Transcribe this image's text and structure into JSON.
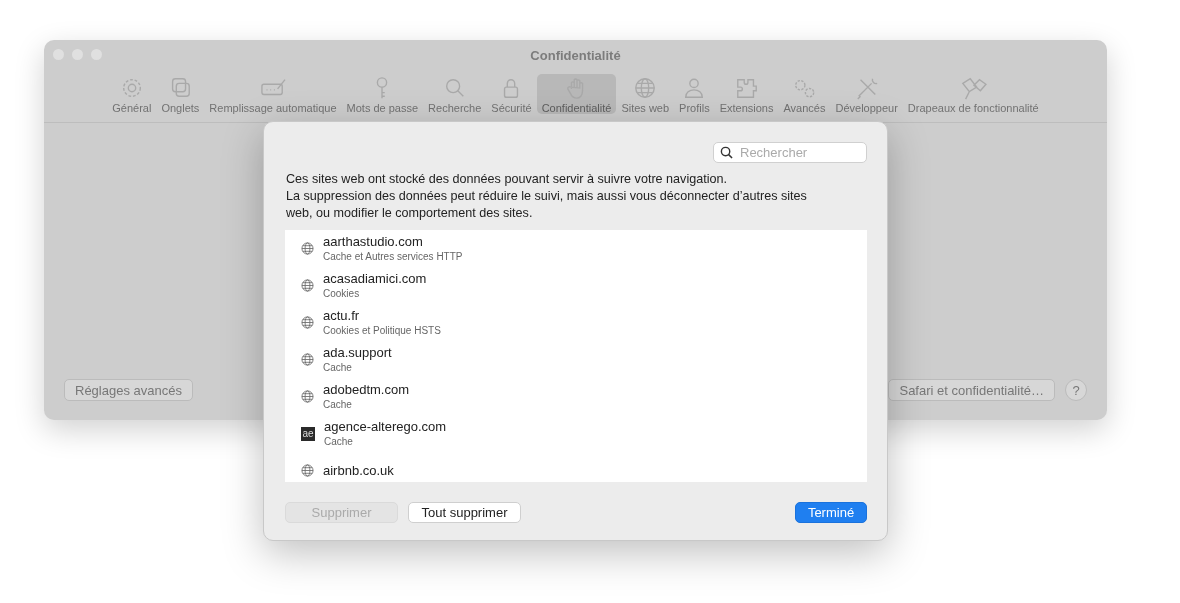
{
  "window": {
    "title": "Confidentialité"
  },
  "toolbar": [
    {
      "label": "Général",
      "selected": false
    },
    {
      "label": "Onglets",
      "selected": false
    },
    {
      "label": "Remplissage automatique",
      "selected": false
    },
    {
      "label": "Mots de passe",
      "selected": false
    },
    {
      "label": "Recherche",
      "selected": false
    },
    {
      "label": "Sécurité",
      "selected": false
    },
    {
      "label": "Confidentialité",
      "selected": true
    },
    {
      "label": "Sites web",
      "selected": false
    },
    {
      "label": "Profils",
      "selected": false
    },
    {
      "label": "Extensions",
      "selected": false
    },
    {
      "label": "Avancés",
      "selected": false
    },
    {
      "label": "Développeur",
      "selected": false
    },
    {
      "label": "Drapeaux de fonctionnalité",
      "selected": false
    }
  ],
  "window_buttons": {
    "left": "Réglages avancés",
    "right": "Safari et confidentialité…",
    "help": "?"
  },
  "sheet": {
    "search": {
      "placeholder": "Rechercher"
    },
    "description": [
      "Ces sites web ont stocké des données pouvant servir à suivre votre navigation.",
      "La suppression des données peut réduire le suivi, mais aussi vous déconnecter d’autres sites web, ou modifier le comportement des sites."
    ],
    "sites": [
      {
        "kind": "globe",
        "name": "aarthastudio.com",
        "data": "Cache et Autres services HTTP"
      },
      {
        "kind": "globe",
        "name": "acasadiamici.com",
        "data": "Cookies"
      },
      {
        "kind": "globe",
        "name": "actu.fr",
        "data": "Cookies et Politique HSTS"
      },
      {
        "kind": "globe",
        "name": "ada.support",
        "data": "Cache"
      },
      {
        "kind": "globe",
        "name": "adobedtm.com",
        "data": "Cache"
      },
      {
        "kind": "favicon",
        "favicon_text": "ae",
        "name": "agence-alterego.com",
        "data": "Cache"
      },
      {
        "kind": "globe",
        "name": "airbnb.co.uk"
      }
    ],
    "buttons": [
      {
        "label": "Supprimer",
        "disabled": true,
        "kind": "plain"
      },
      {
        "label": "Tout supprimer",
        "disabled": false,
        "kind": "plain"
      },
      {
        "label": "Terminé",
        "disabled": false,
        "kind": "default"
      }
    ]
  }
}
